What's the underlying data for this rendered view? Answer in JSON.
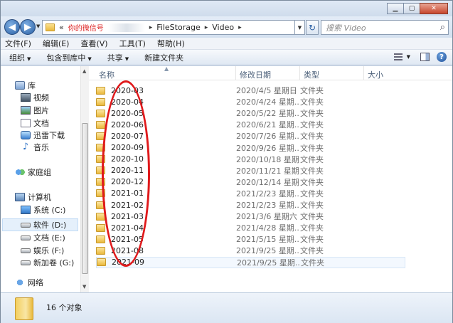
{
  "address": {
    "path": [
      "«",
      "你的微信号",
      "FileStorage",
      "Video"
    ],
    "search_placeholder": "搜索 Video"
  },
  "menu": [
    "文件(F)",
    "编辑(E)",
    "查看(V)",
    "工具(T)",
    "帮助(H)"
  ],
  "commands": [
    {
      "label": "组织",
      "dropdown": true
    },
    {
      "label": "包含到库中",
      "dropdown": true
    },
    {
      "label": "共享",
      "dropdown": true
    },
    {
      "label": "新建文件夹",
      "dropdown": false
    }
  ],
  "nav": {
    "library": "库",
    "library_items": [
      "视频",
      "图片",
      "文档",
      "迅雷下载",
      "音乐"
    ],
    "homegroup": "家庭组",
    "computer": "计算机",
    "drives": [
      "系统 (C:)",
      "软件 (D:)",
      "文档 (E:)",
      "娱乐 (F:)",
      "新加卷 (G:)"
    ],
    "network": "网络"
  },
  "columns": {
    "name": "名称",
    "date": "修改日期",
    "type": "类型",
    "size": "大小"
  },
  "files": [
    {
      "name": "2020-03",
      "date": "2020/4/5 星期日 ...",
      "type": "文件夹"
    },
    {
      "name": "2020-04",
      "date": "2020/4/24 星期...",
      "type": "文件夹"
    },
    {
      "name": "2020-05",
      "date": "2020/5/22 星期...",
      "type": "文件夹"
    },
    {
      "name": "2020-06",
      "date": "2020/6/21 星期...",
      "type": "文件夹"
    },
    {
      "name": "2020-07",
      "date": "2020/7/26 星期...",
      "type": "文件夹"
    },
    {
      "name": "2020-09",
      "date": "2020/9/26 星期...",
      "type": "文件夹"
    },
    {
      "name": "2020-10",
      "date": "2020/10/18 星期...",
      "type": "文件夹"
    },
    {
      "name": "2020-11",
      "date": "2020/11/21 星期...",
      "type": "文件夹"
    },
    {
      "name": "2020-12",
      "date": "2020/12/14 星期...",
      "type": "文件夹"
    },
    {
      "name": "2021-01",
      "date": "2021/2/23 星期...",
      "type": "文件夹"
    },
    {
      "name": "2021-02",
      "date": "2021/2/23 星期...",
      "type": "文件夹"
    },
    {
      "name": "2021-03",
      "date": "2021/3/6 星期六 ...",
      "type": "文件夹"
    },
    {
      "name": "2021-04",
      "date": "2021/4/28 星期...",
      "type": "文件夹"
    },
    {
      "name": "2021-05",
      "date": "2021/5/15 星期...",
      "type": "文件夹"
    },
    {
      "name": "2021-08",
      "date": "2021/9/25 星期...",
      "type": "文件夹"
    },
    {
      "name": "2021-09",
      "date": "2021/9/25 星期...",
      "type": "文件夹"
    }
  ],
  "status": {
    "count": "16 个对象"
  },
  "colors": {
    "accent": "#2a5fa3",
    "annotation": "#e0191b"
  }
}
